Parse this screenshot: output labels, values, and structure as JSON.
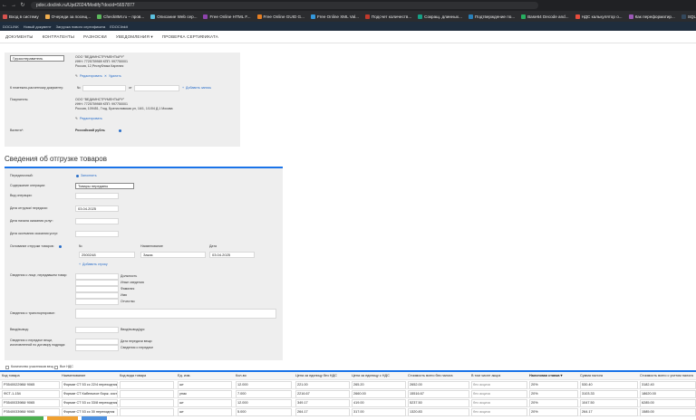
{
  "browser": {
    "url": "pdoc.doclink.ru/Upd2024/Modify?docid=5657877",
    "bookmarks": [
      "Вход в систему",
      "Очереди за посещ...",
      "Check8MI.ru – пров...",
      "Описание Web сер...",
      "Free Online HTML F...",
      "Free Online GUID G...",
      "Free Online XML Val...",
      "Подсчет количеств...",
      "Сокращ. длинных...",
      "Подтверждение по...",
      "Base64 Decode and...",
      "НДС калькулятор о...",
      "Как переформатир...",
      "SQL Formatter & Be..."
    ]
  },
  "appbar": [
    "DOCLINK",
    "Новый документ",
    "Загрузка нового сертификата",
    "EDOClinkit"
  ],
  "menu": [
    "ДОКУМЕНТЫ",
    "КОНТРАГЕНТЫ",
    "РАЗНОСКИ",
    "УВЕДОМЛЕНИЯ ▾",
    "ПРОВЕРКА СЕРТИФИКАТА"
  ],
  "seller": {
    "role_select": "Грузоотправитель",
    "org_name": "ООО \"ВЕДИИНСТРУМЕНТЫРУ\"",
    "inn": "ИНН: 7725759989 КПП: 997750001",
    "address": "Россия, 12,Республика Карелия",
    "edit": "Редактировать",
    "delete": "Удалить"
  },
  "payment_doc": {
    "label": "К платежно-расчетному документу:",
    "no_label": "№",
    "from_label": "от",
    "add_link": "Добавить запись"
  },
  "buyer": {
    "label": "Покупатель:",
    "org_name": "ООО \"ВЕДИИНСТРУМЕНТЫРУ\"",
    "inn": "ИНН: 7725759989 КПП: 997750001",
    "address": "Россия, 109451, Ггод, Братиславская ул, 16/1, 1/1/04 Д.1 Москва",
    "edit": "Редактировать"
  },
  "currency": {
    "label": "Валюта*:",
    "value": "Российский рубль"
  },
  "shipment": {
    "title": "Сведения об отгрузке товаров",
    "transfer_label": "Передаточный:",
    "transfer_value": "Заполнить",
    "content_label": "Содержание операции:",
    "content_value": "Товары переданы",
    "op_type_label": "Вид операции:",
    "ship_date_label": "Дата отгрузки/ передачи:",
    "ship_date_value": "03.04.2025",
    "start_date_label": "Дата начала оказания услуг:",
    "end_date_label": "Дата окончания оказания услуг:",
    "basis_label": "Основание отгрузки товаров:",
    "basis_col_no": "№",
    "basis_col_name": "Наименование",
    "basis_col_date": "Дата",
    "basis_no": "2500248",
    "basis_name": "Заказ",
    "basis_date": "03.04.2025",
    "basis_add": "Добавить строку",
    "person_label": "Сведения о лице, передавшем товар:",
    "person_fields": [
      "Должность",
      "Иные сведения",
      "Фамилия",
      "Имя",
      "Отчество"
    ],
    "transport_label": "Сведения о транспортировке:",
    "cargo_label": "Ввод/вывод:",
    "cargo_field": "Ввод/вывод/дрс",
    "docs_label": "Сведения о передаче вещи, изготовленной по договору подряда:",
    "docs_fields": [
      "Дата передачи вещи",
      "Сведения о передаче"
    ]
  },
  "table_options": {
    "opt1": "Количество участников вещ",
    "opt2": "Все НДС"
  },
  "table": {
    "headers": [
      "Код товара",
      "Наименование",
      "Код вида товара",
      "Ед. изм.",
      "Кол-во",
      "Цена за единицу без НДС",
      "Цена за единицу с НДС",
      "Стоимость всего без налога",
      "В том числе акциз",
      "Налоговая ставка ▾",
      "Сумма налога",
      "Стоимость всего с учетом налога"
    ],
    "rows": [
      [
        "P3540022988/ 9065",
        "Формат СТ 53 сс 22/4 переходник",
        "",
        "шт",
        "12.000",
        "221.00",
        "265.20",
        "2652.00",
        "без акциза",
        "20%",
        "530.40",
        "3182.40"
      ],
      [
        "ФСТ-1-154",
        "Формат СТ Кабельное борж. сист",
        "",
        "упак",
        "7.000",
        "2216.67",
        "2660.00",
        "15516.67",
        "без акциза",
        "20%",
        "3103.33",
        "18620.00"
      ],
      [
        "P3540033988/ 9065",
        "Формат СТ 53 сс 33/8 переходник",
        "",
        "шт",
        "12.000",
        "349.17",
        "419.00",
        "5237.50",
        "без акциза",
        "20%",
        "1047.50",
        "6285.00"
      ],
      [
        "P3540033988/ 9065",
        "Формат СТ 53 сс 30 переходник",
        "",
        "шт",
        "5.000",
        "264.17",
        "317.00",
        "1320.83",
        "без акциза",
        "20%",
        "264.17",
        "1585.00"
      ]
    ]
  }
}
